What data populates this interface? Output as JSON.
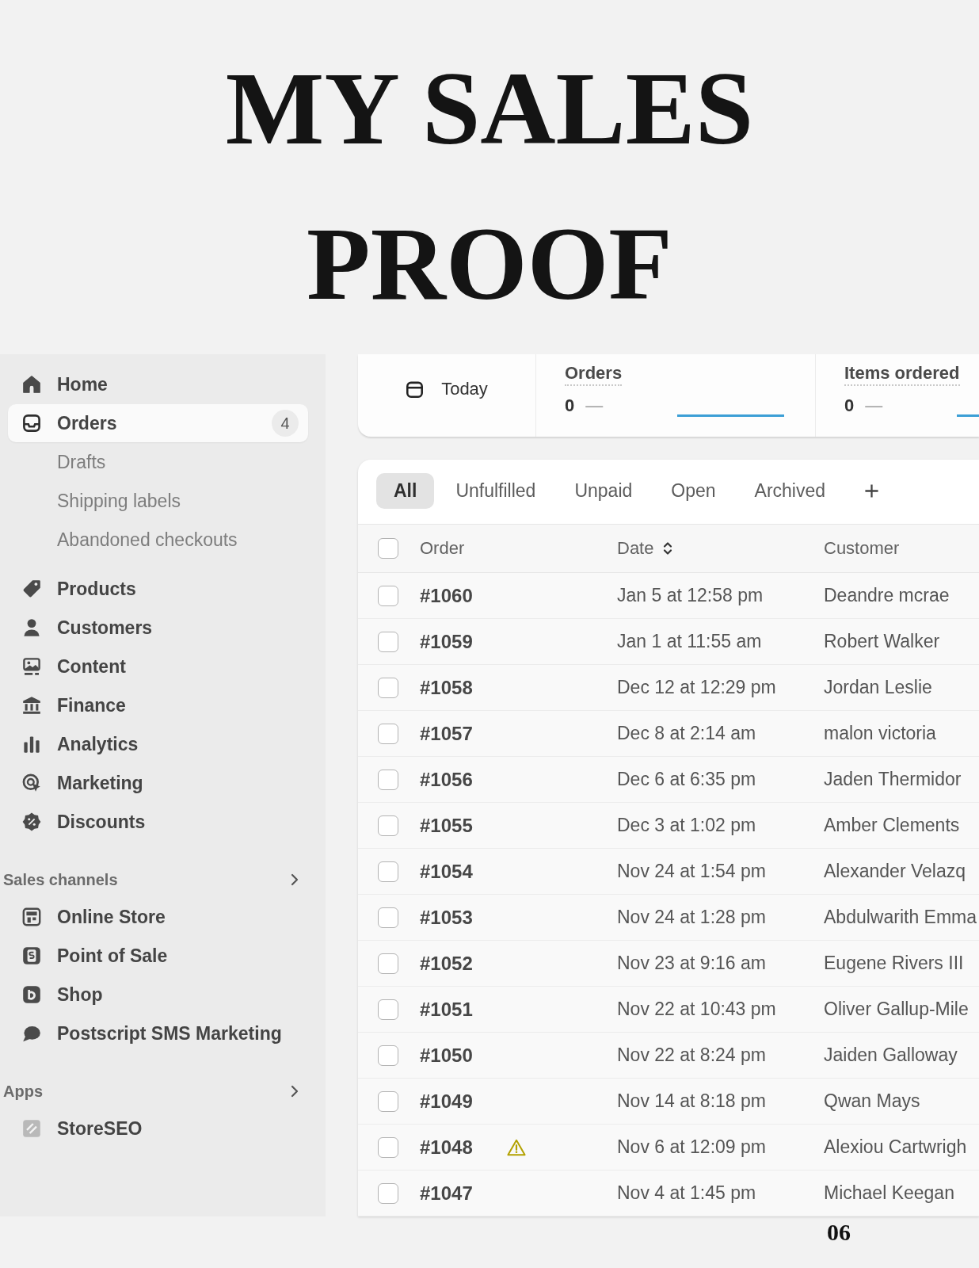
{
  "title": "MY SALES PROOF",
  "sidebar": {
    "items": [
      {
        "label": "Home",
        "selected": false
      },
      {
        "label": "Orders",
        "selected": true,
        "badge": "4",
        "children": [
          {
            "label": "Drafts",
            "selected": false
          },
          {
            "label": "Shipping labels",
            "selected": false
          },
          {
            "label": "Abandoned checkouts",
            "selected": false
          }
        ]
      },
      {
        "label": "Products",
        "selected": false
      },
      {
        "label": "Customers",
        "selected": false
      },
      {
        "label": "Content",
        "selected": false
      },
      {
        "label": "Finance",
        "selected": false
      },
      {
        "label": "Analytics",
        "selected": false
      },
      {
        "label": "Marketing",
        "selected": false
      },
      {
        "label": "Discounts",
        "selected": false
      }
    ],
    "sections": [
      {
        "title": "Sales channels",
        "items": [
          {
            "label": "Online Store",
            "selected": false
          },
          {
            "label": "Point of Sale",
            "selected": false
          },
          {
            "label": "Shop",
            "selected": false
          },
          {
            "label": "Postscript SMS Marketing",
            "selected": false
          }
        ]
      },
      {
        "title": "Apps",
        "items": [
          {
            "label": "StoreSEO",
            "selected": false
          }
        ]
      }
    ]
  },
  "summary": {
    "date_filter": "Today",
    "metrics": [
      {
        "label": "Orders",
        "value": "0",
        "change": "—"
      },
      {
        "label": "Items ordered",
        "value": "0",
        "change": "—"
      }
    ]
  },
  "orders": {
    "tabs": [
      {
        "label": "All",
        "selected": true
      },
      {
        "label": "Unfulfilled",
        "selected": false
      },
      {
        "label": "Unpaid",
        "selected": false
      },
      {
        "label": "Open",
        "selected": false
      },
      {
        "label": "Archived",
        "selected": false
      }
    ],
    "select_all": {
      "checked": false
    },
    "columns": [
      {
        "label": "Order",
        "sortable": false
      },
      {
        "label": "Date",
        "sortable": true
      },
      {
        "label": "Customer",
        "sortable": false
      }
    ],
    "rows": [
      {
        "order": "#1060",
        "date": "Jan 5 at 12:58 pm",
        "customer": "Deandre mcrae",
        "checked": false,
        "warning": false
      },
      {
        "order": "#1059",
        "date": "Jan 1 at 11:55 am",
        "customer": "Robert Walker",
        "checked": false,
        "warning": false
      },
      {
        "order": "#1058",
        "date": "Dec 12 at 12:29 pm",
        "customer": "Jordan Leslie",
        "checked": false,
        "warning": false
      },
      {
        "order": "#1057",
        "date": "Dec 8 at 2:14 am",
        "customer": "malon victoria",
        "checked": false,
        "warning": false
      },
      {
        "order": "#1056",
        "date": "Dec 6 at 6:35 pm",
        "customer": "Jaden Thermidor",
        "checked": false,
        "warning": false
      },
      {
        "order": "#1055",
        "date": "Dec 3 at 1:02 pm",
        "customer": "Amber Clements",
        "checked": false,
        "warning": false
      },
      {
        "order": "#1054",
        "date": "Nov 24 at 1:54 pm",
        "customer": "Alexander Velazq",
        "checked": false,
        "warning": false
      },
      {
        "order": "#1053",
        "date": "Nov 24 at 1:28 pm",
        "customer": "Abdulwarith Emma",
        "checked": false,
        "warning": false
      },
      {
        "order": "#1052",
        "date": "Nov 23 at 9:16 am",
        "customer": "Eugene Rivers III",
        "checked": false,
        "warning": false
      },
      {
        "order": "#1051",
        "date": "Nov 22 at 10:43 pm",
        "customer": "Oliver Gallup-Mile",
        "checked": false,
        "warning": false
      },
      {
        "order": "#1050",
        "date": "Nov 22 at 8:24 pm",
        "customer": "Jaiden Galloway",
        "checked": false,
        "warning": false
      },
      {
        "order": "#1049",
        "date": "Nov 14 at 8:18 pm",
        "customer": "Qwan Mays",
        "checked": false,
        "warning": false
      },
      {
        "order": "#1048",
        "date": "Nov 6 at 12:09 pm",
        "customer": "Alexiou Cartwrigh",
        "checked": false,
        "warning": true
      },
      {
        "order": "#1047",
        "date": "Nov 4 at 1:45 pm",
        "customer": "Michael Keegan",
        "checked": false,
        "warning": false
      }
    ]
  },
  "page_number": "06"
}
